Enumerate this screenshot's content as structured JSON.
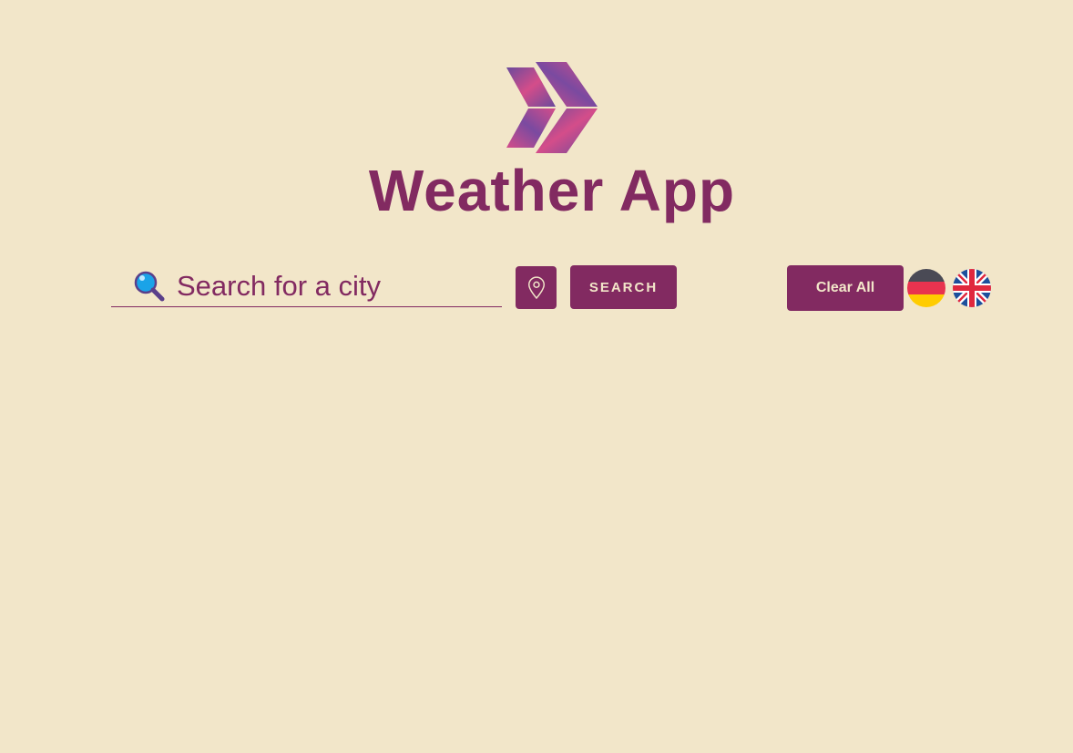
{
  "header": {
    "logo_icon": "double-chevron-logo-icon",
    "title": "Weather App"
  },
  "search": {
    "icon": "magnifier-icon",
    "placeholder": "Search for a city",
    "value": "",
    "location_icon": "map-pin-icon",
    "button_label": "SEARCH"
  },
  "actions": {
    "clear_label": "Clear All"
  },
  "languages": [
    {
      "code": "de",
      "icon": "german-flag-icon"
    },
    {
      "code": "en",
      "icon": "uk-flag-icon"
    }
  ],
  "colors": {
    "background": "#f2e6c9",
    "accent": "#822a61",
    "button_text": "#f2e6c9"
  }
}
